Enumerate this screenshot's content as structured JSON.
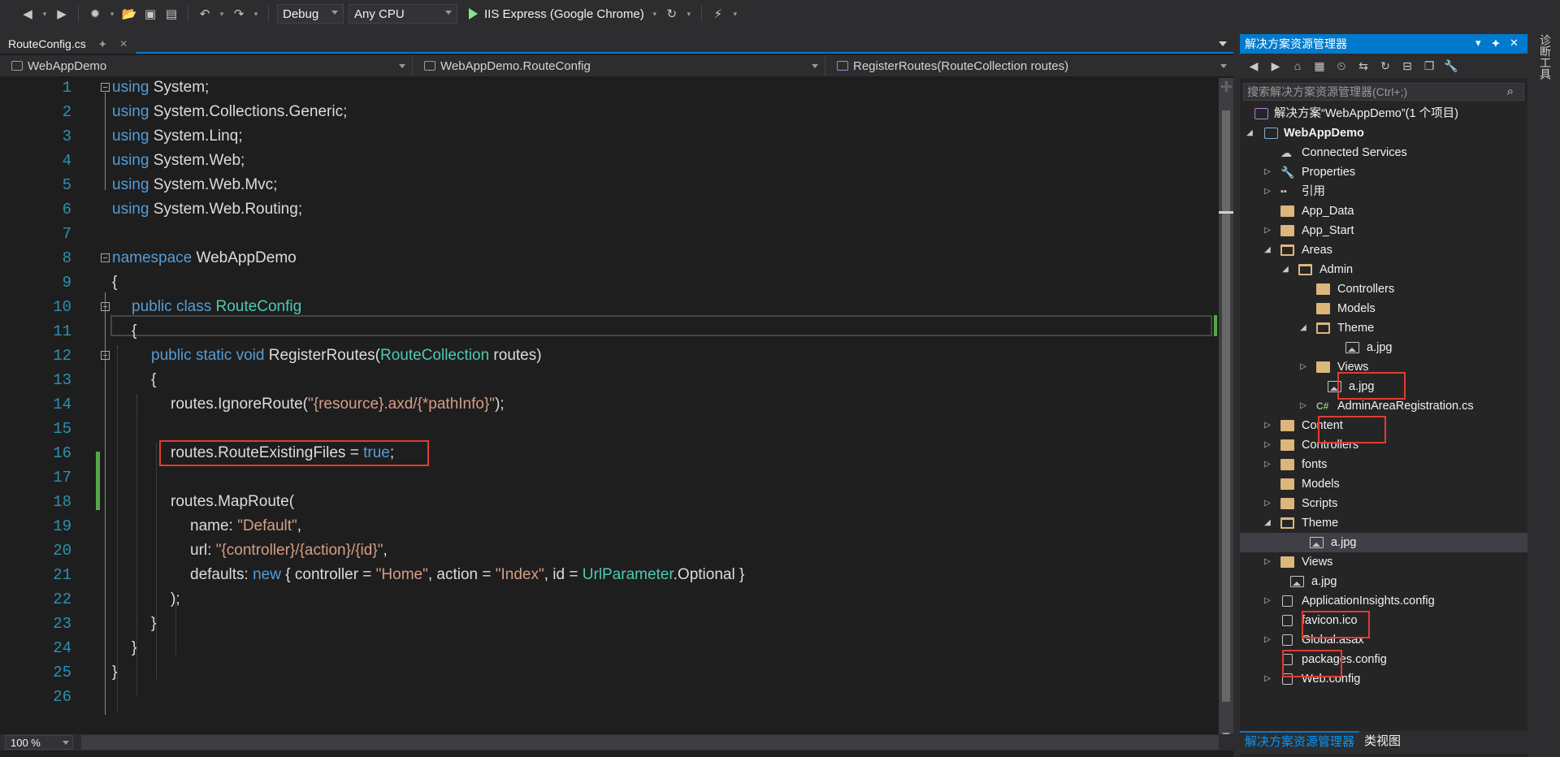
{
  "toolbar": {
    "config": "Debug",
    "platform": "Any CPU",
    "run_target": "IIS Express (Google Chrome)"
  },
  "editor": {
    "tab_title": "RouteConfig.cs",
    "nav_project": "WebAppDemo",
    "nav_class": "WebAppDemo.RouteConfig",
    "nav_member": "RegisterRoutes(RouteCollection routes)",
    "zoom": "100 %",
    "lines": [
      "1",
      "2",
      "3",
      "4",
      "5",
      "6",
      "7",
      "8",
      "9",
      "10",
      "11",
      "12",
      "13",
      "14",
      "15",
      "16",
      "17",
      "18",
      "19",
      "20",
      "21",
      "22",
      "23",
      "24",
      "25",
      "26"
    ]
  },
  "code": {
    "l1": [
      "using",
      " System;"
    ],
    "l2": [
      "using",
      " System.Collections.Generic;"
    ],
    "l3": [
      "using",
      " System.Linq;"
    ],
    "l4": [
      "using",
      " System.Web;"
    ],
    "l5": [
      "using",
      " System.Web.Mvc;"
    ],
    "l6": [
      "using",
      " System.Web.Routing;"
    ],
    "l8": [
      "namespace",
      " WebAppDemo"
    ],
    "l9": "{",
    "l10": [
      "public",
      " ",
      "class",
      " ",
      "RouteConfig"
    ],
    "l11": "{",
    "l12": [
      "public",
      " ",
      "static",
      " ",
      "void",
      " RegisterRoutes(",
      "RouteCollection",
      " routes)"
    ],
    "l13": "{",
    "l14": [
      "routes.IgnoreRoute(",
      "\"{resource}.axd/{*pathInfo}\"",
      ");"
    ],
    "l16": [
      "routes.RouteExistingFiles = ",
      "true",
      ";"
    ],
    "l18": "routes.MapRoute(",
    "l19": [
      "name: ",
      "\"Default\"",
      ","
    ],
    "l20": [
      "url: ",
      "\"{controller}/{action}/{id}\"",
      ","
    ],
    "l21": [
      "defaults: ",
      "new",
      " { controller = ",
      "\"Home\"",
      ", action = ",
      "\"Index\"",
      ", id = ",
      "UrlParameter",
      ".Optional }"
    ],
    "l22": ");",
    "l23": "}",
    "l24": "}",
    "l25": "}"
  },
  "solution_explorer": {
    "title": "解决方案资源管理器",
    "search_placeholder": "搜索解决方案资源管理器(Ctrl+;)",
    "tree": [
      "解决方案“WebAppDemo”(1 个项目)",
      "WebAppDemo",
      "Connected Services",
      "Properties",
      "引用",
      "App_Data",
      "App_Start",
      "Areas",
      "Admin",
      "Controllers",
      "Models",
      "Theme",
      "a.jpg",
      "Views",
      "a.jpg",
      "AdminAreaRegistration.cs",
      "Content",
      "Controllers",
      "fonts",
      "Models",
      "Scripts",
      "Theme",
      "a.jpg",
      "Views",
      "a.jpg",
      "ApplicationInsights.config",
      "favicon.ico",
      "Global.asax",
      "packages.config",
      "Web.config"
    ],
    "tab_solution": "解决方案资源管理器",
    "tab_class": "类视图"
  },
  "right_strip": {
    "label": "诊断工具"
  },
  "colors": {
    "keyword": "#569cd6",
    "type": "#4ec9b0",
    "string": "#d69d85",
    "accent": "#007acc",
    "highlight_box": "#e03c31"
  }
}
